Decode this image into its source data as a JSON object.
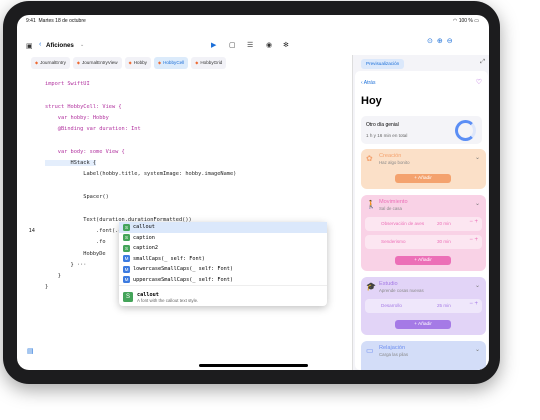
{
  "status": {
    "time": "9:41",
    "date": "Martes 18 de octubre",
    "battery": "100 %"
  },
  "toolbar": {
    "project": "Aficiones"
  },
  "tabs": [
    "JournalEntry",
    "JournalEntryView",
    "Hobby",
    "HobbyCell",
    "HobbyGrid"
  ],
  "active_tab": "HobbyCell",
  "code_lines": [
    {
      "num": "",
      "text": "import SwiftUI"
    },
    {
      "num": "",
      "text": ""
    },
    {
      "num": "",
      "text": "struct HobbyCell: View {"
    },
    {
      "num": "",
      "text": "    var hobby: Hobby"
    },
    {
      "num": "",
      "text": "    @Binding var duration: Int"
    },
    {
      "num": "",
      "text": ""
    },
    {
      "num": "",
      "text": "    var body: some View {"
    },
    {
      "num": "",
      "text": "        HStack {"
    },
    {
      "num": "",
      "text": "            Label(hobby.title, systemImage: hobby.imageName)"
    },
    {
      "num": "",
      "text": ""
    },
    {
      "num": "",
      "text": "            Spacer()"
    },
    {
      "num": "",
      "text": ""
    },
    {
      "num": "",
      "text": "            Text(duration.durationFormatted())"
    },
    {
      "num": "14",
      "text": "                .font(.ca"
    },
    {
      "num": "",
      "text": "                .fo"
    },
    {
      "num": "",
      "text": "            HobbyDe"
    },
    {
      "num": "",
      "text": "        } ···"
    },
    {
      "num": "",
      "text": "    }"
    },
    {
      "num": "",
      "text": "}"
    }
  ],
  "autocomplete": {
    "items": [
      {
        "badge": "S",
        "text": "callout"
      },
      {
        "badge": "S",
        "text": "caption"
      },
      {
        "badge": "S",
        "text": "caption2"
      },
      {
        "badge": "M",
        "text": "smallCaps(_ self: Font)"
      },
      {
        "badge": "M",
        "text": "lowercaseSmallCaps(_ self: Font)"
      },
      {
        "badge": "M",
        "text": "uppercaseSmallCaps(_ self: Font)"
      }
    ],
    "detail_badge": "S",
    "detail_title": "callout",
    "detail_desc": "A font with the callout text style."
  },
  "preview": {
    "button_label": "Previsualización",
    "back_label": "Atrás",
    "title": "Hoy",
    "genial_title": "Otro día genial",
    "genial_time": "1 h y 16 min en total",
    "cards": [
      {
        "title": "Creación",
        "subtitle": "Haz algo bonito",
        "add": "Añadir",
        "bg": "#fbe0c8",
        "accent": "#f4a26e",
        "items": []
      },
      {
        "title": "Movimiento",
        "subtitle": "Sal de casa",
        "add": "Añadir",
        "bg": "#f9d2e6",
        "accent": "#ec6fb7",
        "items": [
          {
            "label": "Observación de aves",
            "time": "20 min"
          },
          {
            "label": "Senderismo",
            "time": "30 min"
          }
        ]
      },
      {
        "title": "Estudio",
        "subtitle": "Aprende cosas nuevas",
        "add": "Añadir",
        "bg": "#e2d4f7",
        "accent": "#a57ae6",
        "items": [
          {
            "label": "Desarrollo",
            "time": "25 min"
          }
        ]
      },
      {
        "title": "Relajación",
        "subtitle": "Carga las pilas",
        "add": "Añadir",
        "bg": "#d3ddf8",
        "accent": "#6e8ff0",
        "items": []
      }
    ]
  }
}
